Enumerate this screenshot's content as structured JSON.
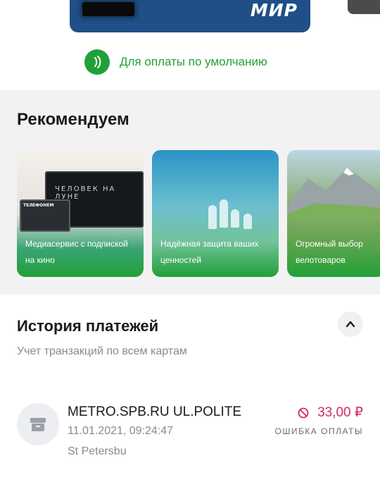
{
  "card": {
    "brand": "МИР"
  },
  "default_payment": {
    "label": "Для оплаты по умолчанию",
    "icon": "nfc-icon",
    "color": "#21a038"
  },
  "recommend": {
    "title": "Рекомендуем",
    "promos": [
      {
        "text": "Медиасервис с подпиской на кино",
        "tv_text": "ЧЕЛОВЕК НА ЛУНЕ",
        "laptop_brand": "ТЕЛЕФОНЕМ"
      },
      {
        "text": "Надёжная защита ваших ценностей"
      },
      {
        "text": "Огромный выбор велотоваров"
      }
    ]
  },
  "history": {
    "title": "История платежей",
    "subtitle": "Учет транзакций по всем картам",
    "collapse_icon": "chevron-up-icon",
    "transactions": [
      {
        "merchant": "METRO.SPB.RU UL.POLITE",
        "datetime": "11.01.2021, 09:24:47",
        "city": "St Petersbu",
        "amount": "33,00 ₽",
        "status": "ОШИБКА ОПЛАТЫ",
        "icon": "store-icon",
        "status_icon": "prohibited-icon",
        "amount_color": "#d52b5d"
      }
    ]
  }
}
